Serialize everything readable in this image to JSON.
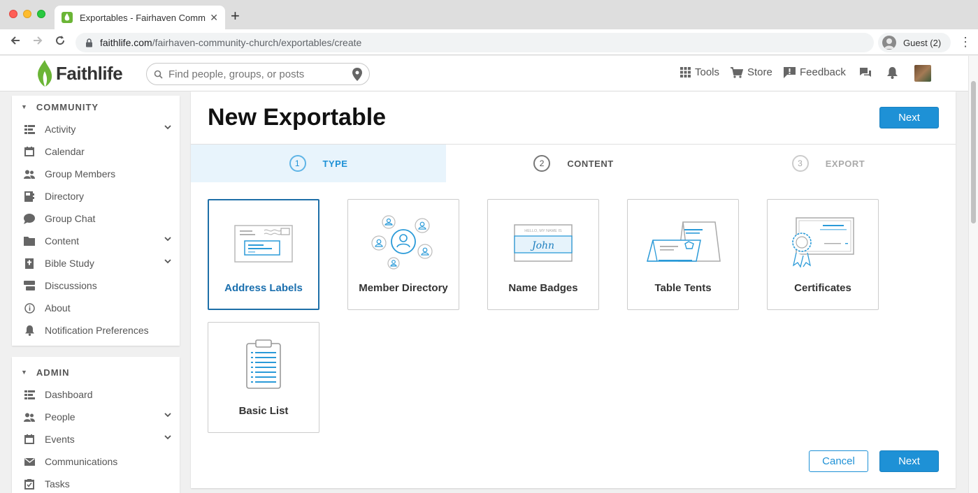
{
  "browser": {
    "tab_title": "Exportables - Fairhaven Comm",
    "url_host": "faithlife.com",
    "url_path": "/fairhaven-community-church/exportables/create",
    "profile_label": "Guest (2)"
  },
  "header": {
    "logo_text": "Faithlife",
    "search_placeholder": "Find people, groups, or posts",
    "tools_label": "Tools",
    "store_label": "Store",
    "feedback_label": "Feedback"
  },
  "sidebar": {
    "community_heading": "COMMUNITY",
    "community_items": [
      {
        "label": "Activity",
        "icon": "activity-icon",
        "expandable": true
      },
      {
        "label": "Calendar",
        "icon": "calendar-icon",
        "expandable": false
      },
      {
        "label": "Group Members",
        "icon": "group-members-icon",
        "expandable": false
      },
      {
        "label": "Directory",
        "icon": "directory-icon",
        "expandable": false
      },
      {
        "label": "Group Chat",
        "icon": "chat-icon",
        "expandable": false
      },
      {
        "label": "Content",
        "icon": "folder-icon",
        "expandable": true
      },
      {
        "label": "Bible Study",
        "icon": "bible-icon",
        "expandable": true
      },
      {
        "label": "Discussions",
        "icon": "discussions-icon",
        "expandable": false
      },
      {
        "label": "About",
        "icon": "info-icon",
        "expandable": false
      },
      {
        "label": "Notification Preferences",
        "icon": "bell-icon",
        "expandable": false
      }
    ],
    "admin_heading": "ADMIN",
    "admin_items": [
      {
        "label": "Dashboard",
        "icon": "dashboard-icon",
        "expandable": false
      },
      {
        "label": "People",
        "icon": "people-icon",
        "expandable": true
      },
      {
        "label": "Events",
        "icon": "calendar-icon",
        "expandable": true
      },
      {
        "label": "Communications",
        "icon": "envelope-icon",
        "expandable": false
      },
      {
        "label": "Tasks",
        "icon": "tasks-icon",
        "expandable": false
      }
    ]
  },
  "main": {
    "title": "New Exportable",
    "next_label": "Next",
    "cancel_label": "Cancel",
    "steps": [
      {
        "number": "1",
        "label": "TYPE",
        "state": "active"
      },
      {
        "number": "2",
        "label": "CONTENT",
        "state": "pending"
      },
      {
        "number": "3",
        "label": "EXPORT",
        "state": "disabled"
      }
    ],
    "types": [
      {
        "label": "Address Labels",
        "selected": true
      },
      {
        "label": "Member Directory",
        "selected": false
      },
      {
        "label": "Name Badges",
        "selected": false
      },
      {
        "label": "Table Tents",
        "selected": false
      },
      {
        "label": "Certificates",
        "selected": false
      },
      {
        "label": "Basic List",
        "selected": false
      }
    ],
    "badge_text_hello": "HELLO, MY NAME IS",
    "badge_text_name": "John"
  },
  "colors": {
    "accent": "#1e91d6",
    "selected_border": "#1e6fa8",
    "step_active_bg": "#e8f4fc",
    "brand_green": "#6bb536"
  }
}
